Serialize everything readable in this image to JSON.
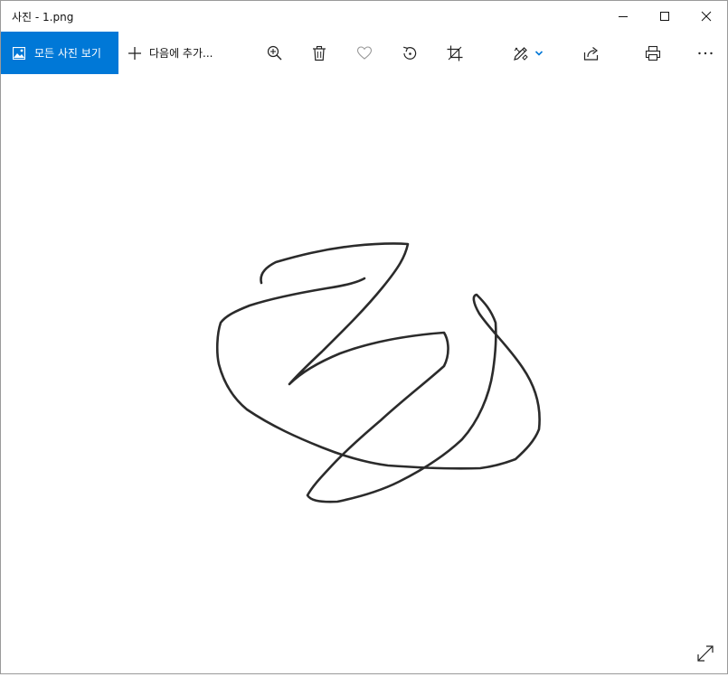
{
  "window": {
    "title": "사진 - 1.png"
  },
  "toolbar": {
    "all_photos_label": "모든 사진 보기",
    "add_to_label": "다음에 추가...",
    "icons": [
      "zoom-in-icon",
      "delete-icon",
      "favorite-heart-icon",
      "rotate-icon",
      "crop-icon",
      "edit-draw-icon",
      "share-icon",
      "print-icon",
      "more-icon"
    ]
  },
  "colors": {
    "accent": "#0078d7",
    "stroke": "#2b2b2b"
  },
  "image": {
    "content": "handwritten-scribble"
  }
}
